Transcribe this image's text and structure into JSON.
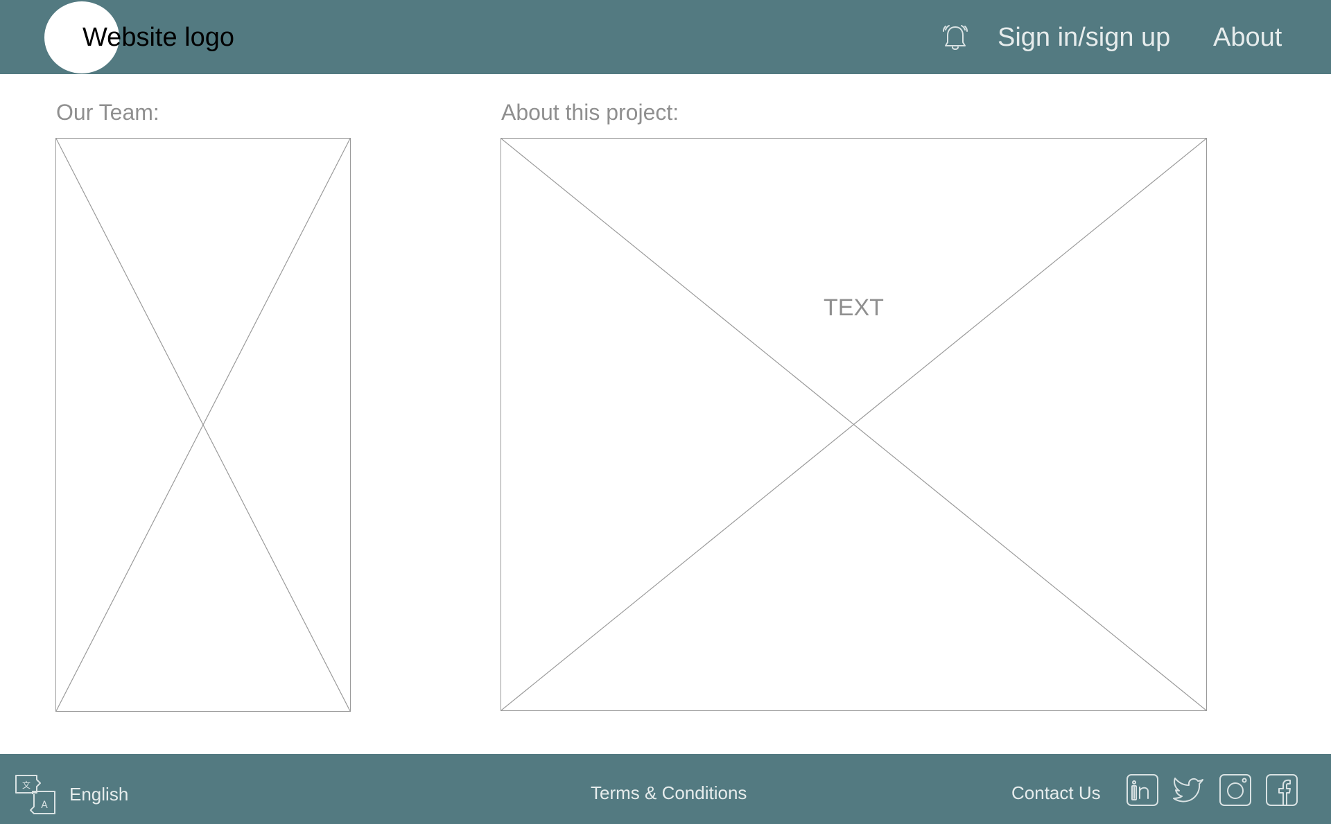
{
  "header": {
    "logo_text": "Website logo",
    "notification_icon": "bell-icon",
    "nav": {
      "signin_label": "Sign in/sign up",
      "about_label": "About"
    }
  },
  "main": {
    "team_label": "Our Team:",
    "project_label": "About this project:",
    "project_placeholder_text": "TEXT"
  },
  "footer": {
    "language_icon": "translate-icon",
    "language_label": "English",
    "terms_label": "Terms & Conditions",
    "contact_label": "Contact Us",
    "social_icons": [
      "linkedin-icon",
      "twitter-icon",
      "instagram-icon",
      "facebook-icon"
    ]
  },
  "colors": {
    "bar_background": "#537a81",
    "bar_text": "#e6ecec",
    "muted_text": "#8f8f8f",
    "placeholder_stroke": "#9a9a9a"
  }
}
